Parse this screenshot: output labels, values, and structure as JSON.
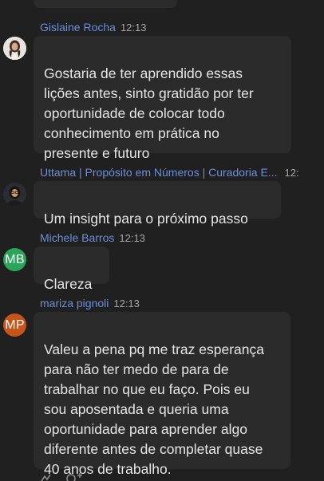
{
  "messages": [
    {
      "sender": "Gislaine Rocha",
      "time": "12:13",
      "avatar": {
        "type": "photo",
        "icon": "user-photo-icon"
      },
      "text": "Gostaria de ter aprendido essas\nlições antes, sinto gratidão por ter\noportunidade de colocar todo\nconhecimento em prática no\npresente e futuro"
    },
    {
      "sender": "Uttama | Propósito em Números | Curadoria E...",
      "time": "12:",
      "avatar": {
        "type": "photo",
        "icon": "user-photo-icon"
      },
      "text": "Um insight para o próximo passo"
    },
    {
      "sender": "Michele Barros",
      "time": "12:13",
      "avatar": {
        "type": "initials",
        "initials": "MB",
        "color": "#2aa65a"
      },
      "text": "Clareza"
    },
    {
      "sender": "mariza pignoli",
      "time": "12:13",
      "avatar": {
        "type": "initials",
        "initials": "MP",
        "color": "#c9541a"
      },
      "text": "Valeu a pena pq me traz esperança\npara não ter medo de para de\ntrabalhar no que eu faço. Pois eu\nsou aposentada e queria uma\noportunidade para aprender algo\ndiferente antes de completar quase\n40 anos de trabalho."
    }
  ],
  "reactions": [
    "add-reaction-icon",
    "add-emoji-icon"
  ]
}
